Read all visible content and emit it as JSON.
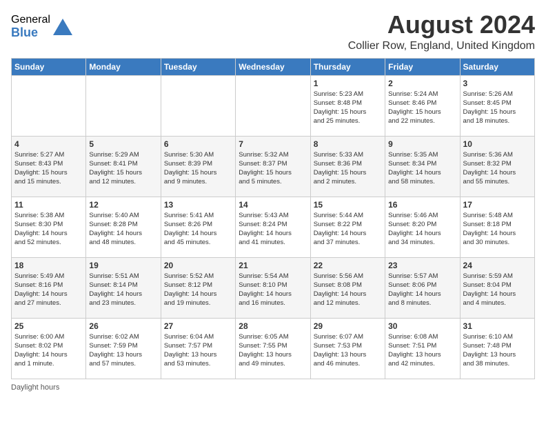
{
  "logo": {
    "general": "General",
    "blue": "Blue"
  },
  "title": "August 2024",
  "location": "Collier Row, England, United Kingdom",
  "days_header": [
    "Sunday",
    "Monday",
    "Tuesday",
    "Wednesday",
    "Thursday",
    "Friday",
    "Saturday"
  ],
  "footer": "Daylight hours",
  "weeks": [
    [
      {
        "day": "",
        "info": ""
      },
      {
        "day": "",
        "info": ""
      },
      {
        "day": "",
        "info": ""
      },
      {
        "day": "",
        "info": ""
      },
      {
        "day": "1",
        "info": "Sunrise: 5:23 AM\nSunset: 8:48 PM\nDaylight: 15 hours\nand 25 minutes."
      },
      {
        "day": "2",
        "info": "Sunrise: 5:24 AM\nSunset: 8:46 PM\nDaylight: 15 hours\nand 22 minutes."
      },
      {
        "day": "3",
        "info": "Sunrise: 5:26 AM\nSunset: 8:45 PM\nDaylight: 15 hours\nand 18 minutes."
      }
    ],
    [
      {
        "day": "4",
        "info": "Sunrise: 5:27 AM\nSunset: 8:43 PM\nDaylight: 15 hours\nand 15 minutes."
      },
      {
        "day": "5",
        "info": "Sunrise: 5:29 AM\nSunset: 8:41 PM\nDaylight: 15 hours\nand 12 minutes."
      },
      {
        "day": "6",
        "info": "Sunrise: 5:30 AM\nSunset: 8:39 PM\nDaylight: 15 hours\nand 9 minutes."
      },
      {
        "day": "7",
        "info": "Sunrise: 5:32 AM\nSunset: 8:37 PM\nDaylight: 15 hours\nand 5 minutes."
      },
      {
        "day": "8",
        "info": "Sunrise: 5:33 AM\nSunset: 8:36 PM\nDaylight: 15 hours\nand 2 minutes."
      },
      {
        "day": "9",
        "info": "Sunrise: 5:35 AM\nSunset: 8:34 PM\nDaylight: 14 hours\nand 58 minutes."
      },
      {
        "day": "10",
        "info": "Sunrise: 5:36 AM\nSunset: 8:32 PM\nDaylight: 14 hours\nand 55 minutes."
      }
    ],
    [
      {
        "day": "11",
        "info": "Sunrise: 5:38 AM\nSunset: 8:30 PM\nDaylight: 14 hours\nand 52 minutes."
      },
      {
        "day": "12",
        "info": "Sunrise: 5:40 AM\nSunset: 8:28 PM\nDaylight: 14 hours\nand 48 minutes."
      },
      {
        "day": "13",
        "info": "Sunrise: 5:41 AM\nSunset: 8:26 PM\nDaylight: 14 hours\nand 45 minutes."
      },
      {
        "day": "14",
        "info": "Sunrise: 5:43 AM\nSunset: 8:24 PM\nDaylight: 14 hours\nand 41 minutes."
      },
      {
        "day": "15",
        "info": "Sunrise: 5:44 AM\nSunset: 8:22 PM\nDaylight: 14 hours\nand 37 minutes."
      },
      {
        "day": "16",
        "info": "Sunrise: 5:46 AM\nSunset: 8:20 PM\nDaylight: 14 hours\nand 34 minutes."
      },
      {
        "day": "17",
        "info": "Sunrise: 5:48 AM\nSunset: 8:18 PM\nDaylight: 14 hours\nand 30 minutes."
      }
    ],
    [
      {
        "day": "18",
        "info": "Sunrise: 5:49 AM\nSunset: 8:16 PM\nDaylight: 14 hours\nand 27 minutes."
      },
      {
        "day": "19",
        "info": "Sunrise: 5:51 AM\nSunset: 8:14 PM\nDaylight: 14 hours\nand 23 minutes."
      },
      {
        "day": "20",
        "info": "Sunrise: 5:52 AM\nSunset: 8:12 PM\nDaylight: 14 hours\nand 19 minutes."
      },
      {
        "day": "21",
        "info": "Sunrise: 5:54 AM\nSunset: 8:10 PM\nDaylight: 14 hours\nand 16 minutes."
      },
      {
        "day": "22",
        "info": "Sunrise: 5:56 AM\nSunset: 8:08 PM\nDaylight: 14 hours\nand 12 minutes."
      },
      {
        "day": "23",
        "info": "Sunrise: 5:57 AM\nSunset: 8:06 PM\nDaylight: 14 hours\nand 8 minutes."
      },
      {
        "day": "24",
        "info": "Sunrise: 5:59 AM\nSunset: 8:04 PM\nDaylight: 14 hours\nand 4 minutes."
      }
    ],
    [
      {
        "day": "25",
        "info": "Sunrise: 6:00 AM\nSunset: 8:02 PM\nDaylight: 14 hours\nand 1 minute."
      },
      {
        "day": "26",
        "info": "Sunrise: 6:02 AM\nSunset: 7:59 PM\nDaylight: 13 hours\nand 57 minutes."
      },
      {
        "day": "27",
        "info": "Sunrise: 6:04 AM\nSunset: 7:57 PM\nDaylight: 13 hours\nand 53 minutes."
      },
      {
        "day": "28",
        "info": "Sunrise: 6:05 AM\nSunset: 7:55 PM\nDaylight: 13 hours\nand 49 minutes."
      },
      {
        "day": "29",
        "info": "Sunrise: 6:07 AM\nSunset: 7:53 PM\nDaylight: 13 hours\nand 46 minutes."
      },
      {
        "day": "30",
        "info": "Sunrise: 6:08 AM\nSunset: 7:51 PM\nDaylight: 13 hours\nand 42 minutes."
      },
      {
        "day": "31",
        "info": "Sunrise: 6:10 AM\nSunset: 7:48 PM\nDaylight: 13 hours\nand 38 minutes."
      }
    ]
  ]
}
